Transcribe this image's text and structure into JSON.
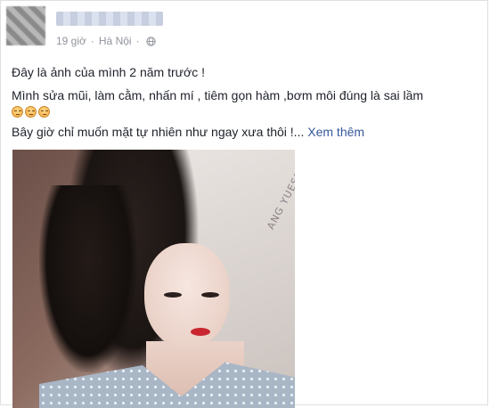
{
  "post": {
    "meta": {
      "time": "19 giờ",
      "separator": "·",
      "location": "Hà Nội"
    },
    "text": {
      "line1": "Đây là ảnh của mình 2 năm trước !",
      "line2": "Mình sửa mũi, làm cằm, nhấn mí , tiêm gọn hàm ,bơm môi đúng là sai lầm",
      "line4": "Bây giờ chỉ muốn mặt tự nhiên như ngay xưa thôi !...",
      "see_more": "Xem thêm"
    },
    "emojis": [
      "relieved-face",
      "relieved-face",
      "relieved-face"
    ],
    "photo": {
      "pillow_text": "ANG YUESP"
    }
  },
  "colors": {
    "link": "#365899",
    "meta": "#90949c",
    "text": "#1d2129"
  }
}
